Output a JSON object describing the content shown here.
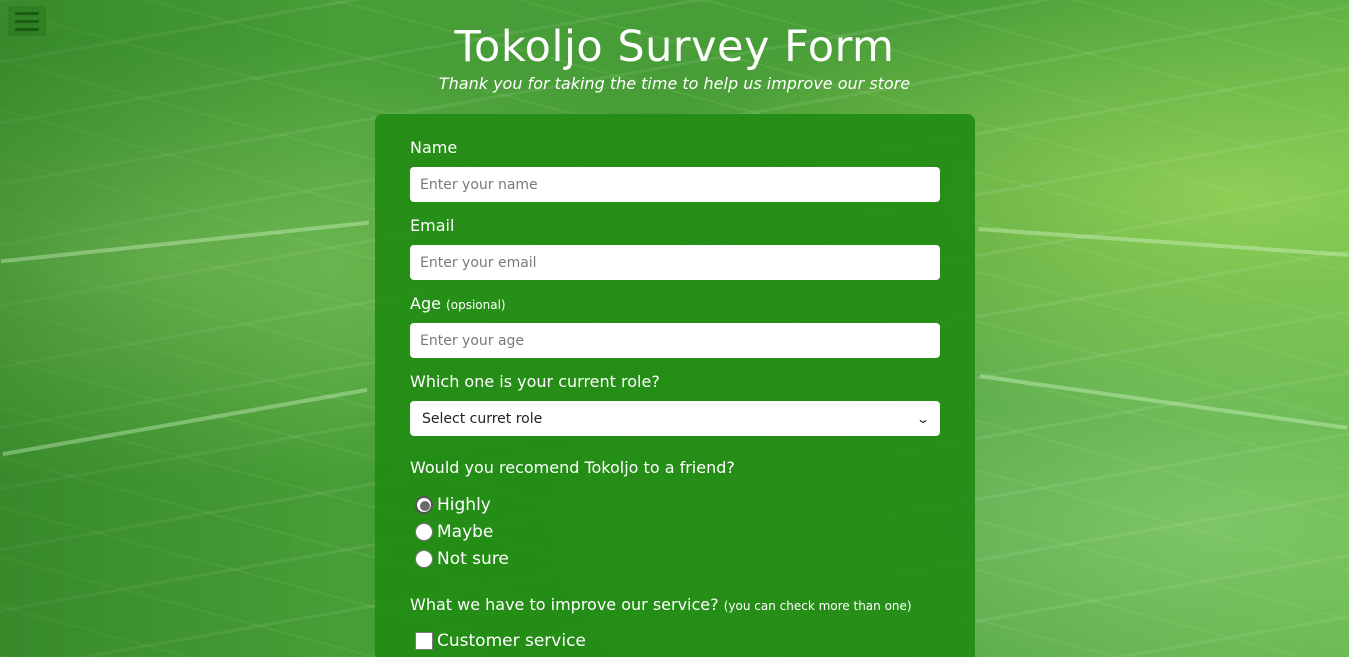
{
  "header": {
    "title": "Tokoljo Survey Form",
    "subtitle": "Thank you for taking the time to help us improve our store",
    "menu_icon": "hamburger-menu-icon"
  },
  "form": {
    "name": {
      "label": "Name",
      "placeholder": "Enter your name"
    },
    "email": {
      "label": "Email",
      "placeholder": "Enter your email"
    },
    "age": {
      "label": "Age",
      "label_note": "(opsional)",
      "placeholder": "Enter your age"
    },
    "role": {
      "label": "Which one is your current role?",
      "selected": "Select curret role"
    },
    "recommend": {
      "label": "Would you recomend Tokoljo to a friend?",
      "options": [
        {
          "label": "Highly",
          "checked": true
        },
        {
          "label": "Maybe",
          "checked": false
        },
        {
          "label": "Not sure",
          "checked": false
        }
      ]
    },
    "improve": {
      "label": "What we have to improve our service?",
      "label_note": "(you can check more than one)",
      "options": [
        {
          "label": "Customer service",
          "checked": false
        }
      ]
    }
  },
  "colors": {
    "card_bg": "#228c14",
    "text": "#ffffff"
  }
}
